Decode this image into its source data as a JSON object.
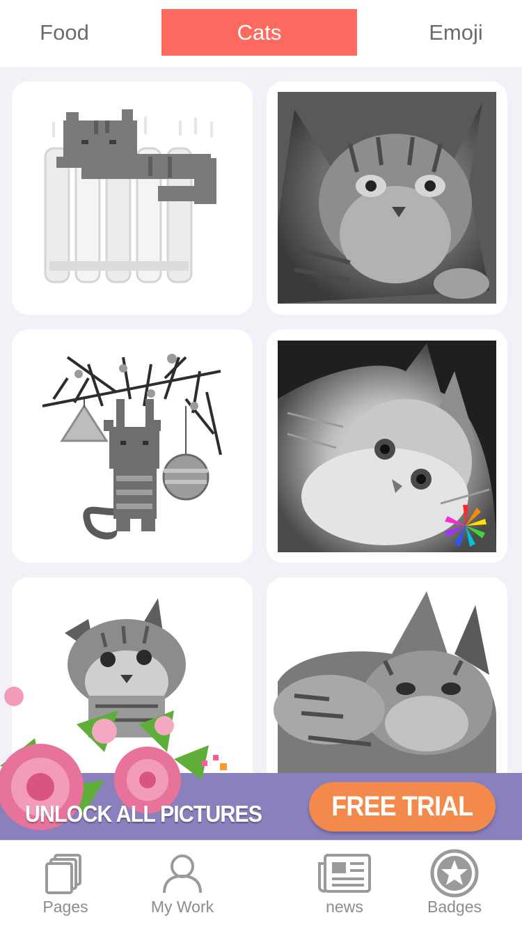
{
  "tabs": [
    {
      "label": "Food",
      "active": false
    },
    {
      "label": "Cats",
      "active": true
    },
    {
      "label": "Emoji",
      "active": false
    }
  ],
  "cards": [
    {
      "subject": "pixel cat on radiator",
      "style": "line-art"
    },
    {
      "subject": "tabby cat photo",
      "style": "photo"
    },
    {
      "subject": "pixel cat hanging on branch with ornaments",
      "style": "line-art"
    },
    {
      "subject": "fluffy kitten photo",
      "style": "photo",
      "badge": "color-wheel-icon"
    },
    {
      "subject": "tabby kitten photo",
      "style": "photo"
    },
    {
      "subject": "cat lying photo",
      "style": "photo"
    }
  ],
  "promo": {
    "text": "UNLOCK ALL PICTURES",
    "button_label": "FREE TRIAL",
    "colors": {
      "banner": "#8a80bd",
      "button": "#f3894a"
    }
  },
  "bottom_nav": [
    {
      "label": "Pages",
      "icon": "pages-icon"
    },
    {
      "label": "My Work",
      "icon": "user-icon"
    },
    {
      "label": "news",
      "icon": "newspaper-icon"
    },
    {
      "label": "Badges",
      "icon": "star-badge-icon"
    }
  ],
  "colors": {
    "accent": "#fe6a60",
    "background": "#f2f1f7"
  }
}
